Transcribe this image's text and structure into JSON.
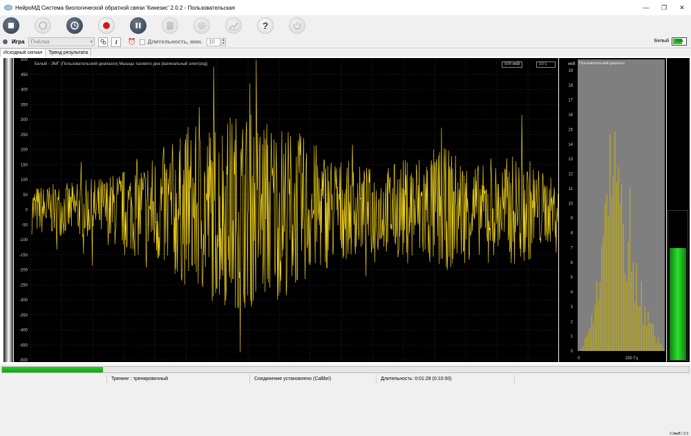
{
  "window": {
    "title": "НейроМД Система биологической обратной связи 'Кинезис' 2.0.2 - Пользовательская",
    "minimize": "—",
    "restore": "❐",
    "close": "✕"
  },
  "toolbar": {
    "buttons": [
      {
        "name": "stop-button",
        "icon": "stop-icon",
        "state": "enabled"
      },
      {
        "name": "settings-disc-button",
        "icon": "disc-icon",
        "state": "disabled"
      },
      {
        "name": "clock-button",
        "icon": "clock-icon",
        "state": "enabled"
      },
      {
        "name": "record-button",
        "icon": "record-icon",
        "state": "enabled"
      },
      {
        "name": "pause-button",
        "icon": "pause-icon",
        "state": "enabled"
      },
      {
        "name": "database-button",
        "icon": "database-icon",
        "state": "disabled"
      },
      {
        "name": "gear-button",
        "icon": "gear-icon",
        "state": "disabled"
      },
      {
        "name": "chart-button",
        "icon": "chart-icon",
        "state": "disabled"
      },
      {
        "name": "help-button",
        "icon": "help-icon",
        "state": "enabled"
      },
      {
        "name": "power-button",
        "icon": "power-icon",
        "state": "disabled"
      }
    ],
    "help_glyph": "?"
  },
  "options": {
    "game_label": "Игра",
    "game_value": "Пчёлка",
    "info_glyph": "i",
    "duration_label": "Длительность, мин.",
    "duration_value": "10",
    "clock_glyph": "⏰"
  },
  "battery": {
    "label": "Белый",
    "percent_text": "70%",
    "level": 0.7
  },
  "tabs": [
    {
      "label": "Исходный сигнал",
      "active": true
    },
    {
      "label": "Тренд результата",
      "active": false
    }
  ],
  "plot": {
    "title": "Белый - ЭМГ (Пользовательский диапазон) Мышцы тазового дна (вагинальный электрод)",
    "amplitude_badge": "500 мкВ",
    "time_badge": "10 с",
    "y_ticks": [
      "500",
      "450",
      "400",
      "350",
      "300",
      "250",
      "200",
      "150",
      "100",
      "50",
      "0",
      "-50",
      "-100",
      "-150",
      "-200",
      "-250",
      "-300",
      "-350",
      "-400",
      "-450",
      "-500"
    ],
    "signal_color": "#f2d31b"
  },
  "histogram": {
    "unit": "мкВ",
    "band_label": "Пользовательский диапазон",
    "y_ticks": [
      "19",
      "18",
      "17",
      "16",
      "15",
      "14",
      "13",
      "12",
      "11",
      "10",
      "9",
      "8",
      "7",
      "6",
      "5",
      "4",
      "3",
      "2",
      "1",
      "0"
    ],
    "x_left": "0",
    "x_mid": "250 Гц"
  },
  "meter": {
    "label": "2.3мкВ / 2.3",
    "level": 0.75,
    "color": "#2ee02e"
  },
  "progress": {
    "fraction": 0.147
  },
  "status": {
    "mode": "Тренинг : тренировочный",
    "connection": "Соединение установлено (Callibri)",
    "duration": "Длительность: 0:01:28 (0:10:00)"
  }
}
